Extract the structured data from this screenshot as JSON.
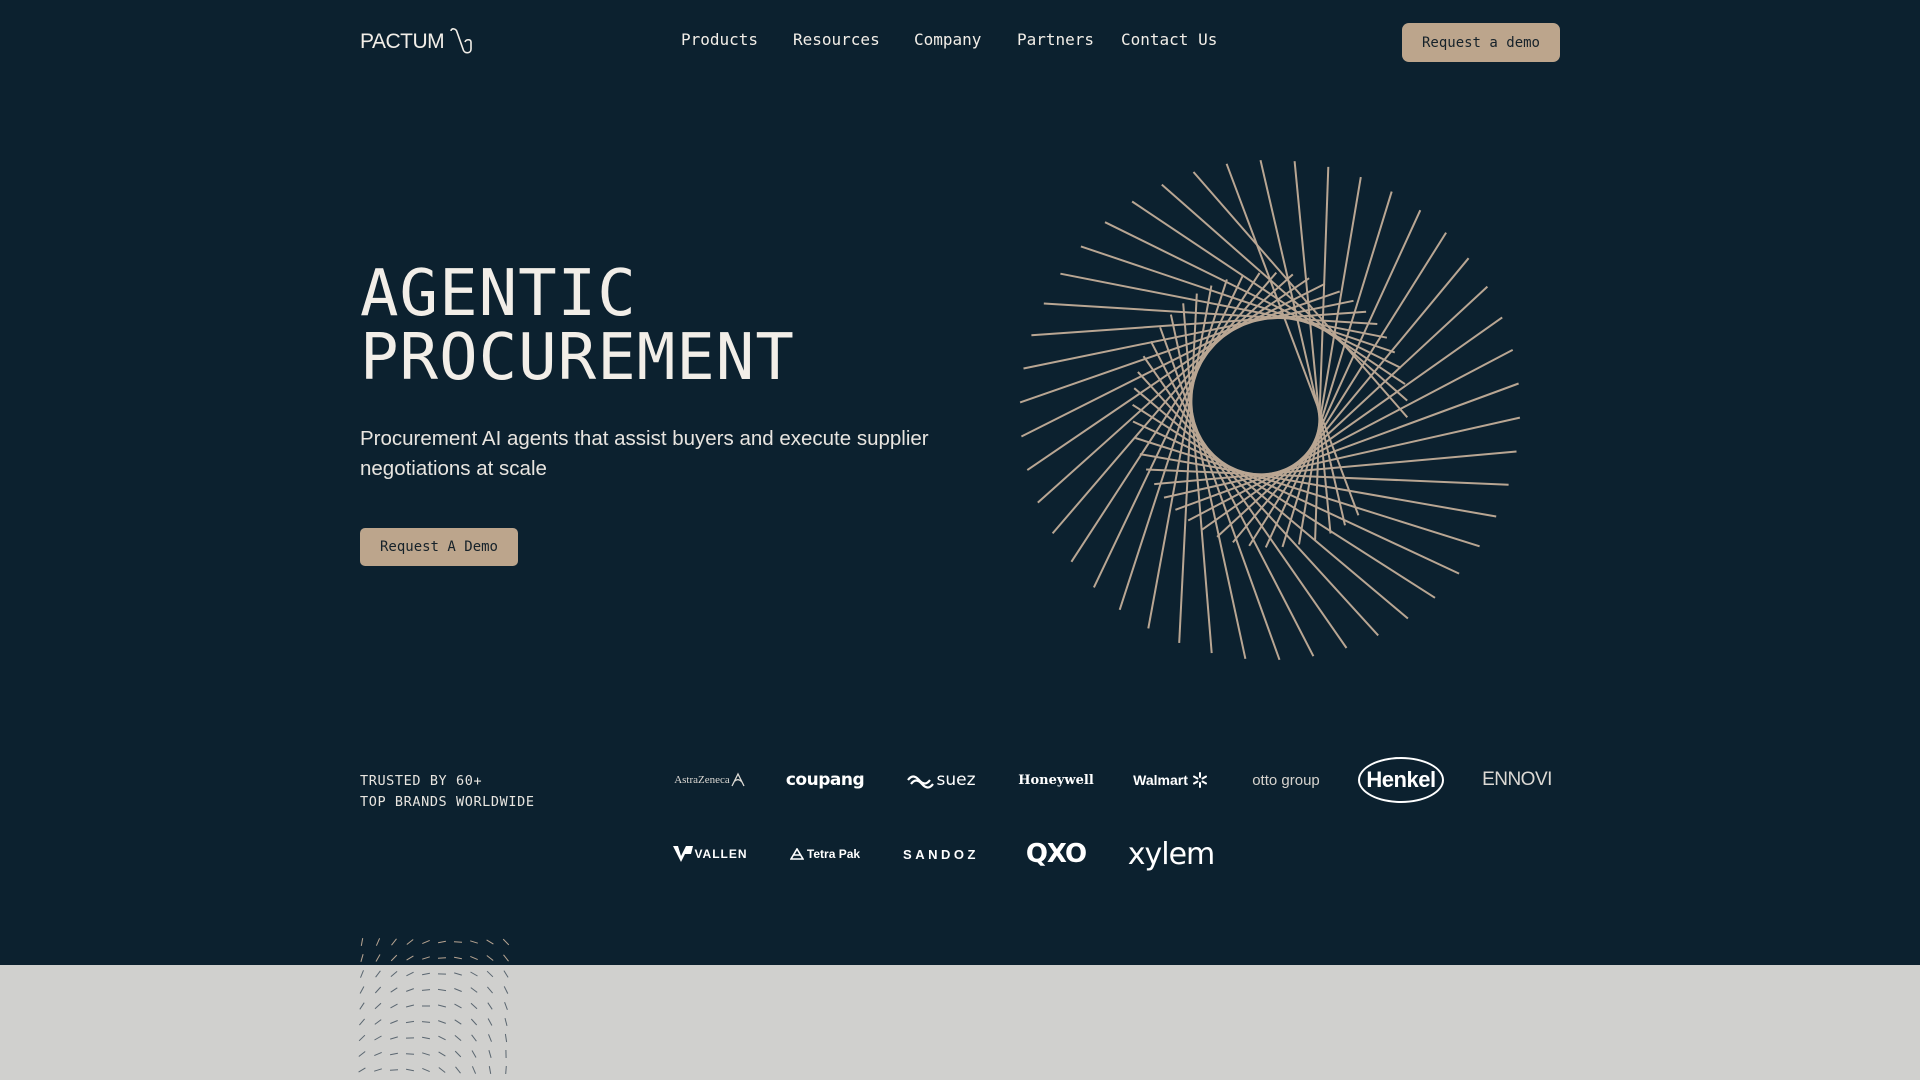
{
  "header": {
    "logo_text": "PACTUM",
    "nav": [
      {
        "label": "Products"
      },
      {
        "label": "Resources"
      },
      {
        "label": "Company"
      },
      {
        "label": "Partners"
      },
      {
        "label": "Contact Us"
      }
    ],
    "cta_label": "Request a demo"
  },
  "hero": {
    "title_line1": "AGENTIC",
    "title_line2": "PROCUREMENT",
    "subtitle": "Procurement AI agents that assist buyers and execute supplier negotiations at scale",
    "cta_label": "Request A Demo"
  },
  "trusted": {
    "line1": "TRUSTED BY 60+",
    "line2": "TOP BRANDS WORLDWIDE",
    "brands_row1": [
      {
        "name": "AstraZeneca",
        "icon": "astrazeneca-logo"
      },
      {
        "name": "coupang",
        "icon": "coupang-logo"
      },
      {
        "name": "suez",
        "icon": "suez-logo"
      },
      {
        "name": "Honeywell",
        "icon": "honeywell-logo"
      },
      {
        "name": "Walmart",
        "icon": "walmart-logo"
      },
      {
        "name": "otto group",
        "icon": "otto-group-logo"
      },
      {
        "name": "Henkel",
        "icon": "henkel-logo"
      },
      {
        "name": "ENNOVI",
        "icon": "ennovi-logo"
      }
    ],
    "brands_row2": [
      {
        "name": "VALLEN",
        "icon": "vallen-logo"
      },
      {
        "name": "Tetra Pak",
        "icon": "tetra-pak-logo"
      },
      {
        "name": "SANDOZ",
        "icon": "sandoz-logo"
      },
      {
        "name": "QXO",
        "icon": "qxo-logo"
      },
      {
        "name": "xylem",
        "icon": "xylem-logo"
      }
    ]
  },
  "colors": {
    "hero_background": "#0c212f",
    "accent": "#bca58c",
    "lower_section_background": "#d0d0ce"
  }
}
